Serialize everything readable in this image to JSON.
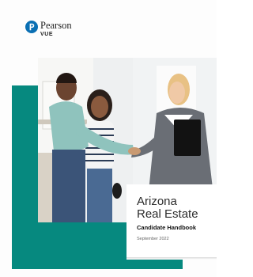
{
  "logo": {
    "brand": "Pearson",
    "sub": "VUE",
    "mark_icon": "pearson-p-logo-icon",
    "mark_color": "#0a6fb3"
  },
  "cover": {
    "title_line1": "Arizona",
    "title_line2": "Real Estate",
    "subtitle": "Candidate Handbook",
    "date": "September 2022",
    "accent_color": "#06897f"
  },
  "photo": {
    "subject": "cover-photo"
  }
}
